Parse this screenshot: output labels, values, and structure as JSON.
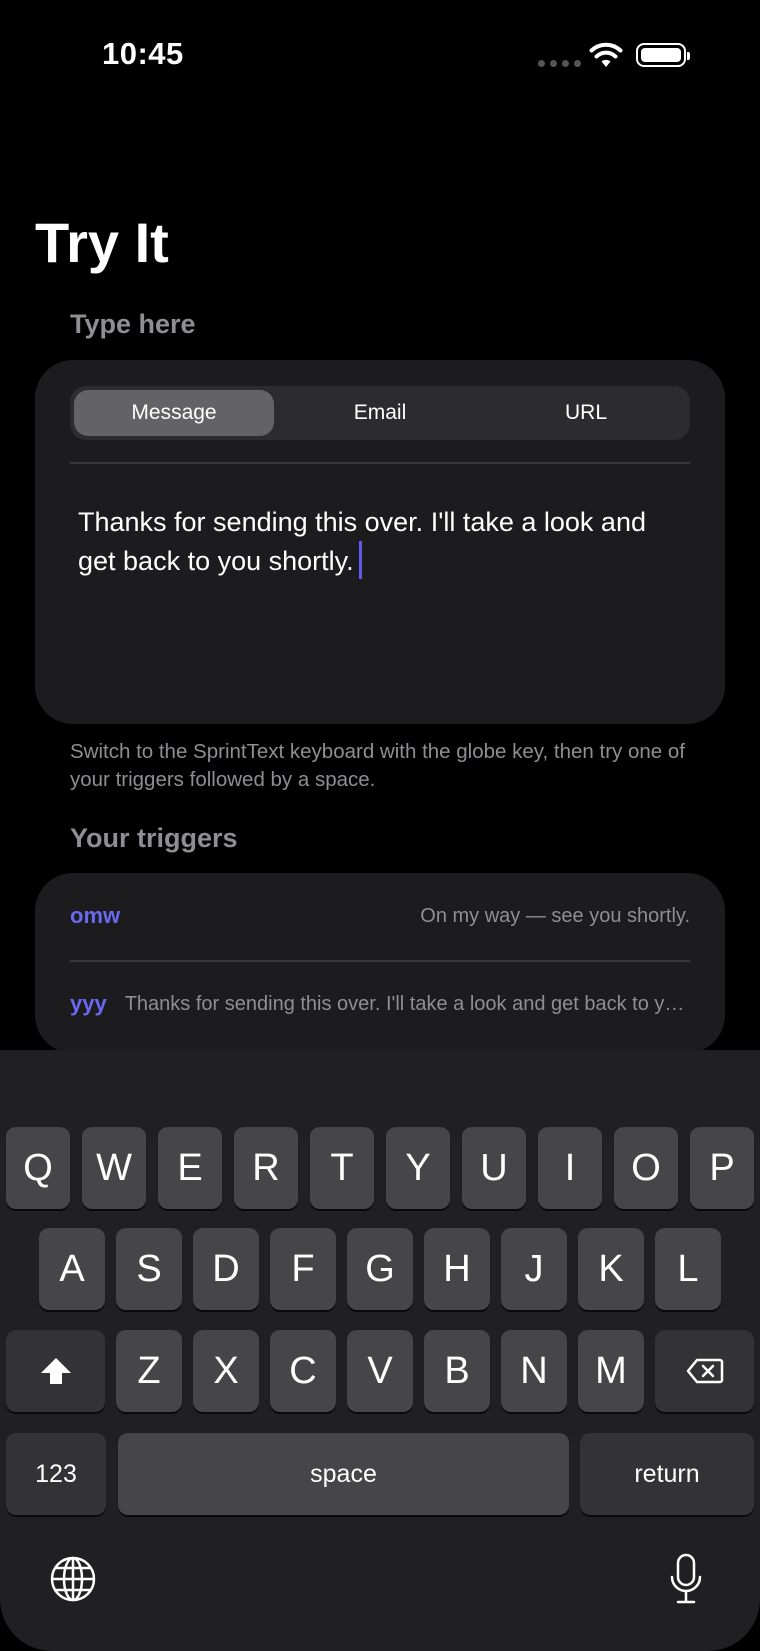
{
  "status": {
    "time": "10:45"
  },
  "page": {
    "title": "Try It"
  },
  "type_section": {
    "label": "Type here",
    "tabs": [
      {
        "label": "Message",
        "active": true
      },
      {
        "label": "Email",
        "active": false
      },
      {
        "label": "URL",
        "active": false
      }
    ],
    "text": "Thanks for sending this over. I'll take a look and get back to you shortly."
  },
  "help_text": "Switch to the SprintText keyboard with the globe key, then try one of your triggers followed by a space.",
  "triggers_section": {
    "label": "Your triggers",
    "items": [
      {
        "trigger": "omw",
        "expansion": "On my way — see you shortly."
      },
      {
        "trigger": "yyy",
        "expansion": "Thanks for sending this over. I'll take a look and get back to you shortly."
      }
    ]
  },
  "keyboard": {
    "row1": [
      "Q",
      "W",
      "E",
      "R",
      "T",
      "Y",
      "U",
      "I",
      "O",
      "P"
    ],
    "row2": [
      "A",
      "S",
      "D",
      "F",
      "G",
      "H",
      "J",
      "K",
      "L"
    ],
    "row3": [
      "Z",
      "X",
      "C",
      "V",
      "B",
      "N",
      "M"
    ],
    "numbers_key": "123",
    "space_key": "space",
    "return_key": "return",
    "icons": {
      "shift": "shift-icon",
      "delete": "delete-icon",
      "globe": "globe-icon",
      "mic": "microphone-icon"
    }
  },
  "colors": {
    "accent": "#5e5ce6",
    "card": "#1c1c1e",
    "key": "#464648",
    "muted": "#8e8e93"
  }
}
